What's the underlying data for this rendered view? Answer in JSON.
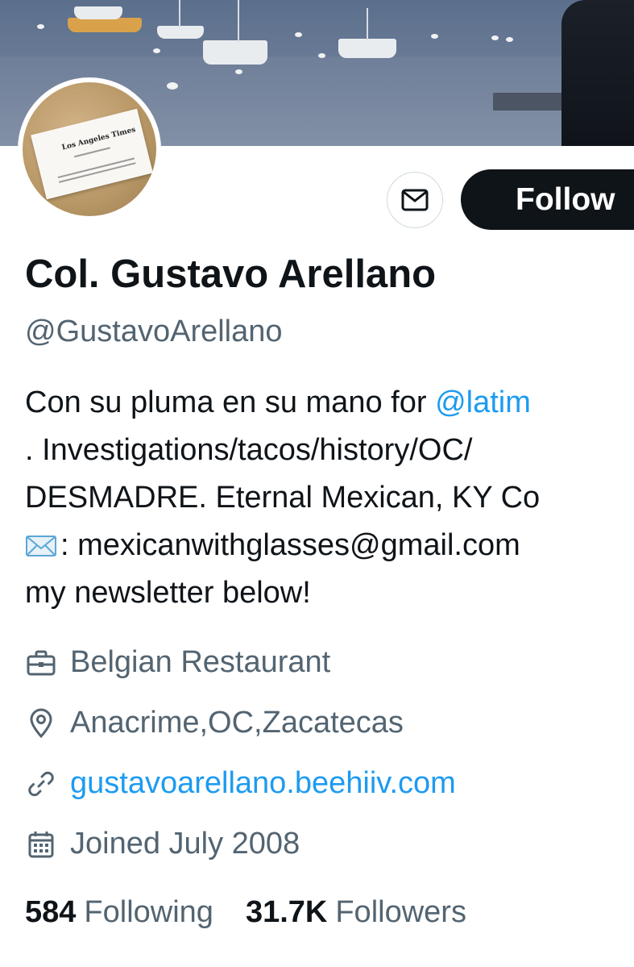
{
  "profile": {
    "name": "Col. Gustavo Arellano",
    "handle": "@GustavoArellano",
    "bio": {
      "line1_text": "Con su pluma en su mano for ",
      "line1_mention": "@latim",
      "line2": ". Investigations/tacos/history/OC/",
      "line3": "DESMADRE. Eternal Mexican, KY Co",
      "line4_emoji": "envelope-emoji",
      "line4_text": ": mexicanwithglasses@gmail.com",
      "line5": "my newsletter below!"
    },
    "avatar_card_text": "Los Angeles Times",
    "meta": {
      "profession": {
        "icon": "briefcase-icon",
        "text": "Belgian Restaurant"
      },
      "location": {
        "icon": "location-pin-icon",
        "text": "Anacrime,OC,Zacatecas"
      },
      "website": {
        "icon": "link-icon",
        "text": "gustavoarellano.beehiiv.com"
      },
      "joined": {
        "icon": "calendar-icon",
        "text": "Joined July 2008"
      }
    },
    "stats": {
      "following_count": "584",
      "following_label": "Following",
      "followers_count": "31.7K",
      "followers_label": "Followers"
    }
  },
  "actions": {
    "message_icon": "envelope-icon",
    "follow_label": "Follow"
  },
  "colors": {
    "text_primary": "#0f1419",
    "text_secondary": "#536471",
    "link": "#1d9bf0",
    "button_dark": "#0f1419",
    "border": "#cfd9de"
  }
}
